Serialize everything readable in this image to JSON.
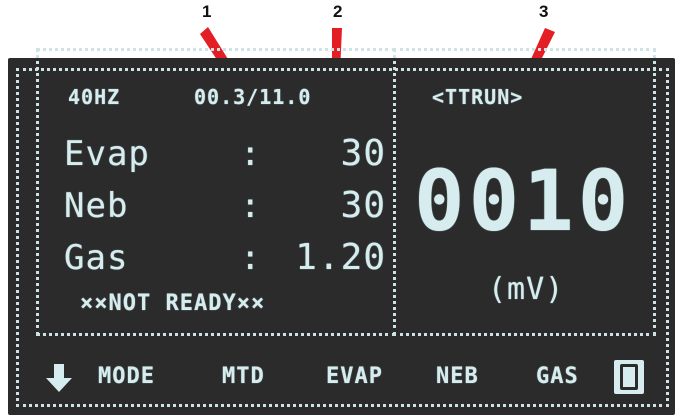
{
  "callouts": {
    "one": "1",
    "two": "2",
    "three": "3",
    "arrow_color": "#e31e24"
  },
  "display": {
    "header": {
      "frequency": "40HZ",
      "temps": "00.3/11.0",
      "mode": "<TTRUN>"
    },
    "rows": [
      {
        "label": "Evap",
        "sep": ":",
        "value": "30"
      },
      {
        "label": "Neb",
        "sep": ":",
        "value": "30"
      },
      {
        "label": "Gas",
        "sep": ":",
        "value": "1.20"
      }
    ],
    "status": "××NOT READY××",
    "reading": "0010",
    "unit": "(mV)",
    "softkeys": [
      "MODE",
      "MTD",
      "EVAP",
      "NEB",
      "GAS"
    ],
    "icons": {
      "scroll": "down-arrow-icon",
      "lock": "lock-icon"
    },
    "colors": {
      "background": "#2b2b2b",
      "text": "#d6ecee"
    }
  }
}
